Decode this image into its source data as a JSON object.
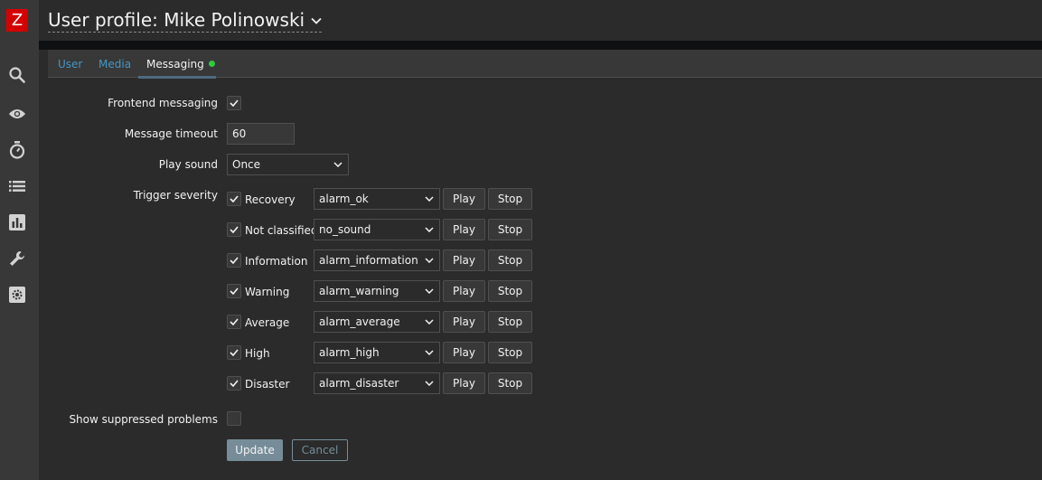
{
  "sidebar": {
    "logo": "Z",
    "icons": [
      "search-icon",
      "eye-icon",
      "stopwatch-icon",
      "list-icon",
      "bar-chart-icon",
      "wrench-icon",
      "gear-icon"
    ]
  },
  "header": {
    "title": "User profile: Mike Polinowski"
  },
  "tabs": [
    {
      "label": "User"
    },
    {
      "label": "Media"
    },
    {
      "label": "Messaging"
    }
  ],
  "form": {
    "frontend_messaging": {
      "label": "Frontend messaging",
      "checked": true
    },
    "message_timeout": {
      "label": "Message timeout",
      "value": "60"
    },
    "play_sound": {
      "label": "Play sound",
      "value": "Once"
    },
    "trigger_severity": {
      "label": "Trigger severity",
      "play_label": "Play",
      "stop_label": "Stop",
      "rows": [
        {
          "name": "Recovery",
          "sound": "alarm_ok",
          "checked": true
        },
        {
          "name": "Not classified",
          "sound": "no_sound",
          "checked": true
        },
        {
          "name": "Information",
          "sound": "alarm_information",
          "checked": true
        },
        {
          "name": "Warning",
          "sound": "alarm_warning",
          "checked": true
        },
        {
          "name": "Average",
          "sound": "alarm_average",
          "checked": true
        },
        {
          "name": "High",
          "sound": "alarm_high",
          "checked": true
        },
        {
          "name": "Disaster",
          "sound": "alarm_disaster",
          "checked": true
        }
      ]
    },
    "show_suppressed": {
      "label": "Show suppressed problems",
      "checked": false
    },
    "update_label": "Update",
    "cancel_label": "Cancel"
  },
  "colors": {
    "accent_link": "#4796c4",
    "status_dot": "#2ecc40",
    "logo_red": "#d40000"
  }
}
